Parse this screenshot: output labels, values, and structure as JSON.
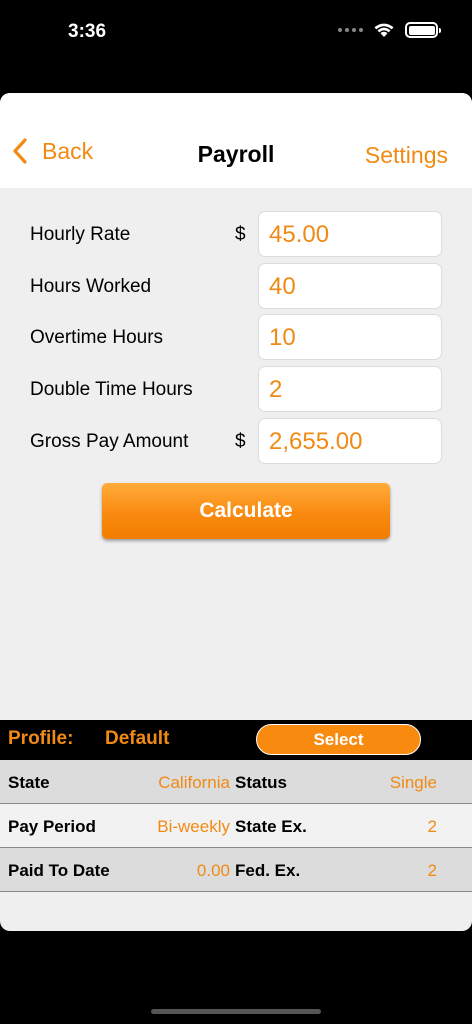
{
  "status": {
    "time": "3:36"
  },
  "nav": {
    "back_label": "Back",
    "title": "Payroll",
    "settings_label": "Settings"
  },
  "form": {
    "hourly_rate": {
      "label": "Hourly Rate",
      "currency": "$",
      "value": "45.00"
    },
    "hours_worked": {
      "label": "Hours Worked",
      "value": "40"
    },
    "overtime_hours": {
      "label": "Overtime Hours",
      "value": "10"
    },
    "double_time_hours": {
      "label": "Double Time Hours",
      "value": "2"
    },
    "gross_pay": {
      "label": "Gross Pay Amount",
      "currency": "$",
      "value": "2,655.00"
    }
  },
  "calculate_label": "Calculate",
  "profile": {
    "label": "Profile:",
    "value": "Default",
    "select_label": "Select"
  },
  "info": {
    "state": {
      "key": "State",
      "value": "California"
    },
    "status": {
      "key": "Status",
      "value": "Single"
    },
    "pay_period": {
      "key": "Pay Period",
      "value": "Bi-weekly"
    },
    "state_ex": {
      "key": "State Ex.",
      "value": "2"
    },
    "paid_to_date": {
      "key": "Paid To Date",
      "value": "0.00"
    },
    "fed_ex": {
      "key": "Fed. Ex.",
      "value": "2"
    }
  },
  "colors": {
    "accent": "#f08a14",
    "button": "#f98a10",
    "background": "#efefef"
  }
}
